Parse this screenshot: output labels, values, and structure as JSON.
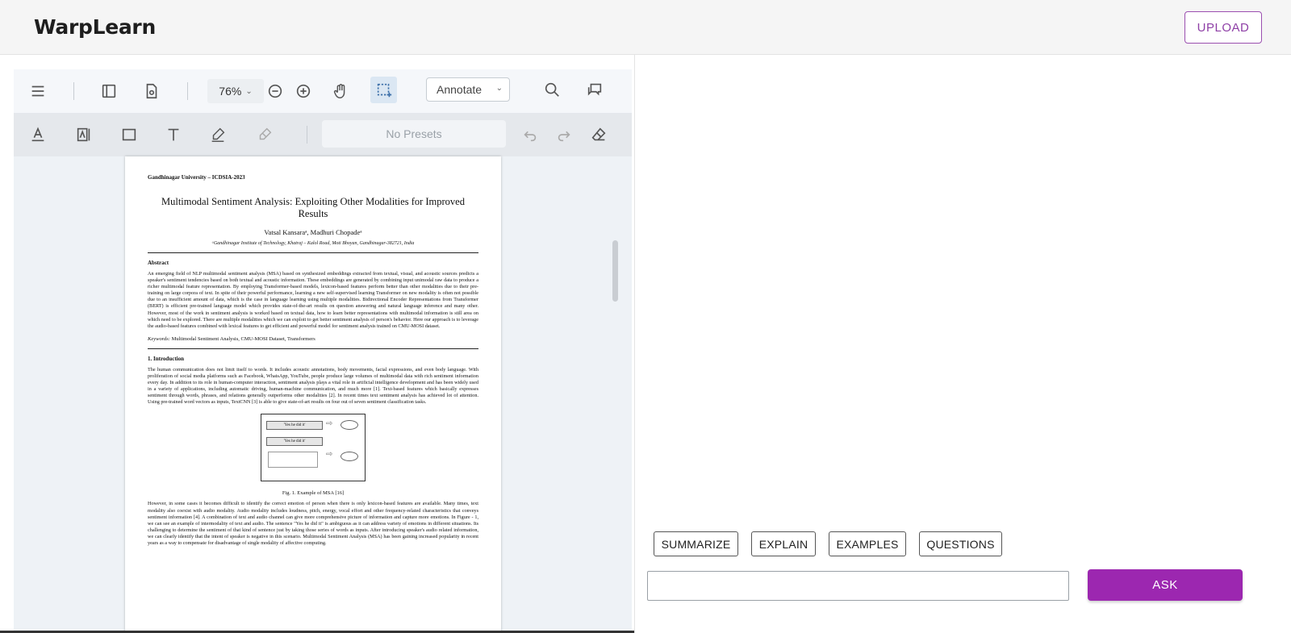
{
  "app": {
    "title": "WarpLearn",
    "upload_label": "UPLOAD"
  },
  "viewer": {
    "zoom": "76%",
    "mode": "Annotate",
    "presets_placeholder": "No Presets",
    "toolbar_icons": [
      "menu-icon",
      "sidebar-icon",
      "page-settings-icon",
      "zoom-out-icon",
      "zoom-in-icon",
      "hand-pan-icon",
      "area-select-icon",
      "search-icon",
      "comments-icon"
    ],
    "annotation_icons": [
      "text-underline-icon",
      "text-highlight-icon",
      "rectangle-icon",
      "text-icon",
      "pen-icon",
      "eraser-pen-icon",
      "undo-icon",
      "redo-icon",
      "eraser-icon"
    ]
  },
  "document": {
    "header": "Gandhinagar University – ICDSIA-2023",
    "title": "Multimodal Sentiment Analysis: Exploiting Other Modalities for Improved Results",
    "authors": "Vatsal Kansaraᵃ, Madhuri Chopadeᵃ",
    "affiliation": "ᵃGandhinagar Institute of Technology, Khatraj – Kalol Road, Moti Bhoyan, Gandhinagar-382721, India",
    "abstract_heading": "Abstract",
    "abstract": "An emerging field of NLP multimodal sentiment analysis (MSA) based on synthesized embeddings extracted from textual, visual, and acoustic sources predicts a speaker's sentiment tendencies based on both textual and acoustic information. These embeddings are generated by combining input unimodal raw data to produce a richer multimodal feature representation. By employing Transformer-based models, lexicon-based features perform better than other modalities due to their pre-training on large corpora of text. In spite of their powerful performance, learning a new self-supervised learning Transformer on new modality is often not possible due to an insufficient amount of data, which is the case in language learning using multiple modalities. Bidirectional Encoder Representations from Transformer (BERT) is efficient pre-trained language model which provides state-of-the-art results on question answering and natural language inference and many other. However, most of the work in sentiment analysis is worked based on textual data, how to learn better representations with multimodal information is still area on which need to be explored. There are multiple modalities which we can exploit to get better sentiment analysis of person's behavior. Here our approach is to leverage the audio-based features combined with lexical features to get efficient and powerful model for sentiment analysis trained on CMU-MOSI dataset.",
    "keywords_label": "Keywords:",
    "keywords": "Multimodal Sentiment Analysis, CMU-MOSI Dataset, Transformers",
    "intro_heading": "1. Introduction",
    "intro": "The human communication does not limit itself to words. It includes acoustic annotations, body movements, facial expressions, and even body language. With proliferation of social media platforms such as Facebook, WhatsApp, YouTube, people produce large volumes of multimodal data with rich sentiment information every day. In addition to its role in human-computer interaction, sentiment analysis plays a vital role in artificial intelligence development and has been widely used in a variety of applications, including automatic driving, human-machine communication, and much more [1]. Text-based features which basically expresses sentiment through words, phrases, and relations generally outperforms other modalities [2]. In recent times text sentiment analysis has achieved lot of attention. Using pre-trained word vectors as inputs, TextCNN [3] is able to give state-of-art results on four out of seven sentiment classification tasks.",
    "figure": {
      "box1": "'Yes he did it'",
      "box2": "'Yes he did it'",
      "caption": "Fig. 1. Example of MSA [16]"
    },
    "para2": "However, in some cases it becomes difficult to identify the correct emotion of person when there is only lexicon-based features are available. Many times, text modality also coexist with audio modality. Audio modality includes loudness, pitch, energy, vocal effort and other frequency-related characteristics that conveys sentiment information [4]. A combination of text and audio channel can give more comprehensive picture of information and capture more emotions. In Figure - 1, we can see an example of intermodality of text and audio. The sentence \"Yes he did it\" is ambiguous as it can address variety of emotions in different situations. Its challenging to determine the sentiment of that kind of sentence just by taking those series of words as inputs. After introducing speaker's audio related information, we can clearly identify that the intent of speaker is negative in this scenario. Multimodal Sentiment Analysis (MSA) has been gaining increased popularity in recent years as a way to compensate for disadvantage of single modality of affective computing."
  },
  "actions": {
    "summarize": "SUMMARIZE",
    "explain": "EXPLAIN",
    "examples": "EXAMPLES",
    "questions": "QUESTIONS"
  },
  "query": {
    "value": "",
    "placeholder": ""
  },
  "ask_label": "ASK",
  "colors": {
    "accent": "#9c27b0",
    "header_bg": "#f5f5f5"
  }
}
